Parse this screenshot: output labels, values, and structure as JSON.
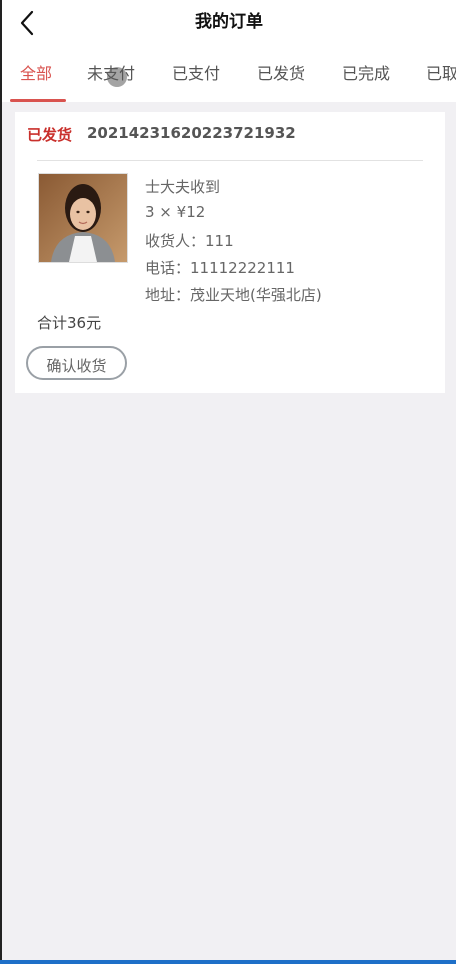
{
  "header": {
    "title": "我的订单",
    "back_icon": "chevron-left-icon"
  },
  "tabs": [
    {
      "label": "全部",
      "active": true
    },
    {
      "label": "未支付",
      "active": false
    },
    {
      "label": "已支付",
      "active": false
    },
    {
      "label": "已发货",
      "active": false
    },
    {
      "label": "已完成",
      "active": false
    },
    {
      "label": "已取",
      "active": false
    }
  ],
  "order": {
    "status": "已发货",
    "order_number": "20214231620223721932",
    "product_name": "士大夫收到",
    "quantity_price": "3 × ¥12",
    "recipient": "收货人：111",
    "phone": "电话：11112222111",
    "address": "地址：茂业天地(华强北店)",
    "total": "合计36元",
    "confirm_label": "确认收货"
  },
  "colors": {
    "accent": "#d9534f",
    "status": "#c9302c",
    "background": "#f1f0f3"
  }
}
